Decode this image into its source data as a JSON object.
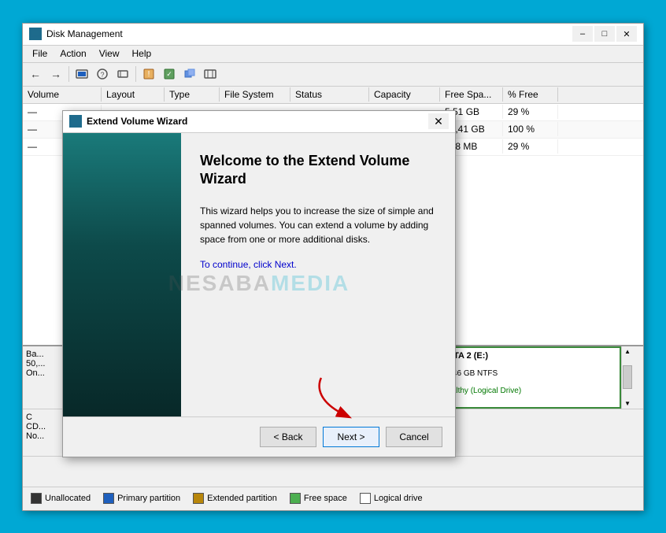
{
  "window": {
    "title": "Disk Management",
    "icon": "disk-icon"
  },
  "menu": {
    "items": [
      "File",
      "Action",
      "View",
      "Help"
    ]
  },
  "table": {
    "headers": [
      "Volume",
      "Layout",
      "Type",
      "File System",
      "Status",
      "Capacity",
      "Free Spa...",
      "% Free"
    ],
    "rows": [
      {
        "volume": "",
        "layout": "",
        "type": "",
        "fs": "",
        "status": "",
        "capacity": "",
        "free": "5,51 GB",
        "pct": "29 %"
      },
      {
        "volume": "",
        "layout": "",
        "type": "",
        "fs": "",
        "status": "",
        "capacity": "",
        "free": "17,41 GB",
        "pct": "100 %"
      },
      {
        "volume": "",
        "layout": "",
        "type": "",
        "fs": "",
        "status": "",
        "capacity": "",
        "free": "168 MB",
        "pct": "29 %"
      }
    ]
  },
  "disk_view": {
    "rows": [
      {
        "label": "Ba...\n50,...\nOn...",
        "parts": [
          {
            "label": "",
            "type": "unallocated",
            "width": "8%"
          },
          {
            "label": "",
            "type": "primary",
            "width": "60%"
          },
          {
            "label": "DATA 2  (E:)\n17,46 GB NTFS\nHealthy (Logical Drive)",
            "type": "logical",
            "width": "30%"
          }
        ]
      },
      {
        "label": "C\nCD...\nNo...",
        "parts": []
      }
    ]
  },
  "legend": {
    "items": [
      {
        "label": "Unallocated",
        "color": "#333333"
      },
      {
        "label": "Primary partition",
        "color": "#1e5fbd"
      },
      {
        "label": "Extended partition",
        "color": "#b8860b"
      },
      {
        "label": "Free space",
        "color": "#4caf50"
      },
      {
        "label": "Logical drive",
        "color": "#ffffff"
      }
    ]
  },
  "dialog": {
    "title": "Extend Volume Wizard",
    "close_btn": "✕",
    "heading": "Welcome to the Extend Volume\nWizard",
    "description": "This wizard helps you to increase the size of simple and spanned volumes. You can extend a volume by adding space from one or more additional disks.",
    "continue_text": "To continue, click Next.",
    "watermark": {
      "part1": "NESABA",
      "part2": "MEDIA"
    },
    "buttons": {
      "back": "< Back",
      "next": "Next >",
      "cancel": "Cancel"
    }
  }
}
